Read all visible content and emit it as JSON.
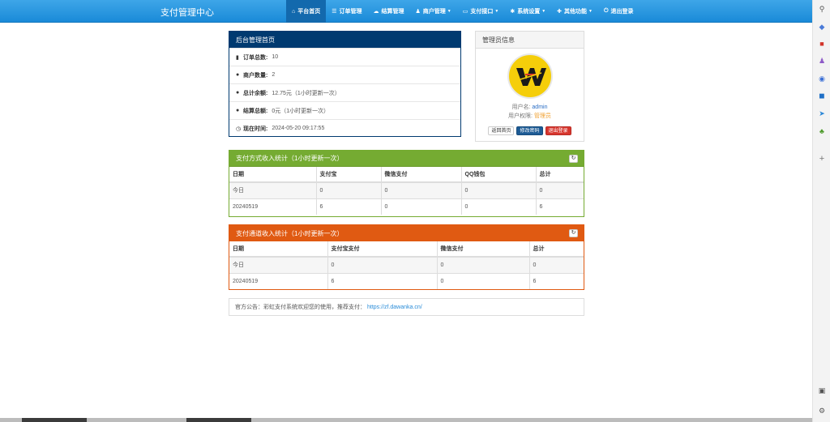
{
  "navbar": {
    "brand": "支付管理中心",
    "items": [
      {
        "label": "平台首页",
        "icon": "home-icon",
        "glyph": "⌂",
        "active": true
      },
      {
        "label": "订单管理",
        "icon": "list-icon",
        "glyph": "☰"
      },
      {
        "label": "结算管理",
        "icon": "cloud-icon",
        "glyph": "☁"
      },
      {
        "label": "商户管理",
        "icon": "user-icon",
        "glyph": "♟",
        "dropdown": true
      },
      {
        "label": "支付接口",
        "icon": "card-icon",
        "glyph": "▭",
        "dropdown": true
      },
      {
        "label": "系统设置",
        "icon": "gear-icon",
        "glyph": "✱",
        "dropdown": true
      },
      {
        "label": "其他功能",
        "icon": "tools-icon",
        "glyph": "✚",
        "dropdown": true
      },
      {
        "label": "退出登录",
        "icon": "power-icon",
        "glyph": "⏻"
      }
    ]
  },
  "overview": {
    "title": "后台管理首页",
    "rows": [
      {
        "icon": "bar-chart-icon",
        "glyph": "▮",
        "label": "订单总数:",
        "value": "10"
      },
      {
        "icon": "drop-icon",
        "glyph": "●",
        "label": "商户数量:",
        "value": "2"
      },
      {
        "icon": "drop-icon",
        "glyph": "●",
        "label": "总计余额:",
        "value": "12.75元（1小时更新一次）"
      },
      {
        "icon": "drop-icon",
        "glyph": "●",
        "label": "结算总额:",
        "value": "0元（1小时更新一次）"
      },
      {
        "icon": "clock-icon",
        "glyph": "◷",
        "label": "现在时间:",
        "value": "2024-05-20 09:17:55"
      }
    ]
  },
  "admin": {
    "title": "管理员信息",
    "username_label": "用户名:",
    "username": "admin",
    "role_label": "用户权限:",
    "role": "管理员",
    "buttons": {
      "home": "返回首页",
      "password": "修改密码",
      "logout": "退出登录"
    }
  },
  "method_stats": {
    "title": "支付方式收入统计（1小时更新一次）",
    "headers": [
      "日期",
      "支付宝",
      "微信支付",
      "QQ钱包",
      "总计"
    ],
    "rows": [
      [
        "今日",
        "0",
        "0",
        "0",
        "0"
      ],
      [
        "20240519",
        "6",
        "0",
        "0",
        "6"
      ]
    ]
  },
  "channel_stats": {
    "title": "支付通道收入统计（1小时更新一次）",
    "headers": [
      "日期",
      "支付宝支付",
      "微信支付",
      "总计"
    ],
    "rows": [
      [
        "今日",
        "0",
        "0",
        "0"
      ],
      [
        "20240519",
        "6",
        "0",
        "6"
      ]
    ]
  },
  "notice": {
    "text": "官方公告：彩虹支付系统欢迎您的使用，推荐支付：",
    "link": "https://zf.dawanka.cn/"
  },
  "rail": [
    {
      "icon": "search-icon",
      "glyph": "⚲",
      "color": "#555555"
    },
    {
      "icon": "tag-icon",
      "glyph": "◆",
      "color": "#4a7bd8"
    },
    {
      "icon": "toolbox-icon",
      "glyph": "■",
      "color": "#d2342a"
    },
    {
      "icon": "people-icon",
      "glyph": "♟",
      "color": "#8e5bc8"
    },
    {
      "icon": "globe-icon",
      "glyph": "◉",
      "color": "#3b6fd6"
    },
    {
      "icon": "outlook-icon",
      "glyph": "◼",
      "color": "#1f6fc6"
    },
    {
      "icon": "send-icon",
      "glyph": "➤",
      "color": "#2a86d6"
    },
    {
      "icon": "tree-icon",
      "glyph": "♣",
      "color": "#4c9a2a"
    },
    {
      "icon": "plus-icon",
      "glyph": "+",
      "color": "#777777"
    },
    {
      "icon": "screen-icon",
      "glyph": "▣",
      "color": "#555555"
    },
    {
      "icon": "settings-icon",
      "glyph": "⚙",
      "color": "#555555"
    }
  ]
}
